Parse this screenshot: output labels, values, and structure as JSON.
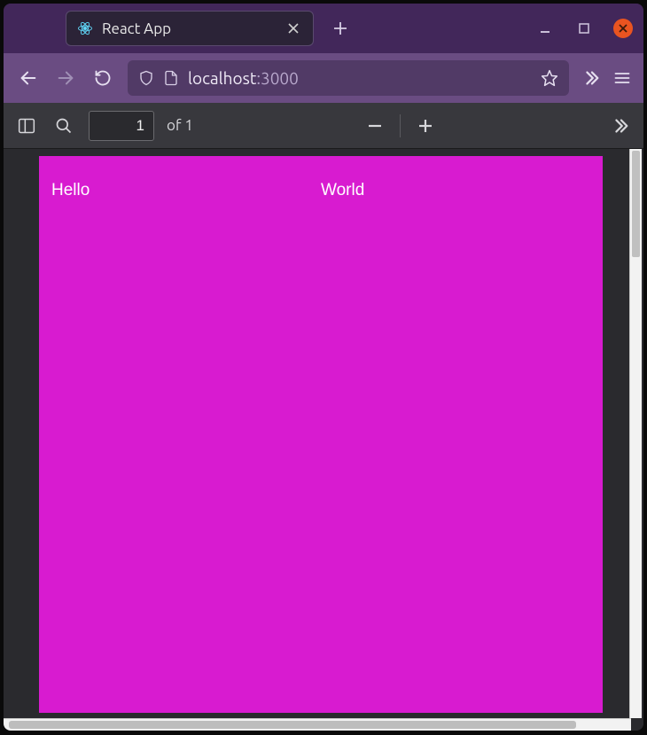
{
  "tabbar": {
    "tab_title": "React App",
    "favicon_name": "react-logo-icon"
  },
  "addressbar": {
    "url_host": "localhost",
    "url_port": ":3000"
  },
  "pdf_toolbar": {
    "page_input_value": "1",
    "page_of_label": "of 1"
  },
  "document": {
    "bg_color": "#d81bd0",
    "columns": [
      {
        "text": "Hello"
      },
      {
        "text": "World"
      }
    ]
  }
}
